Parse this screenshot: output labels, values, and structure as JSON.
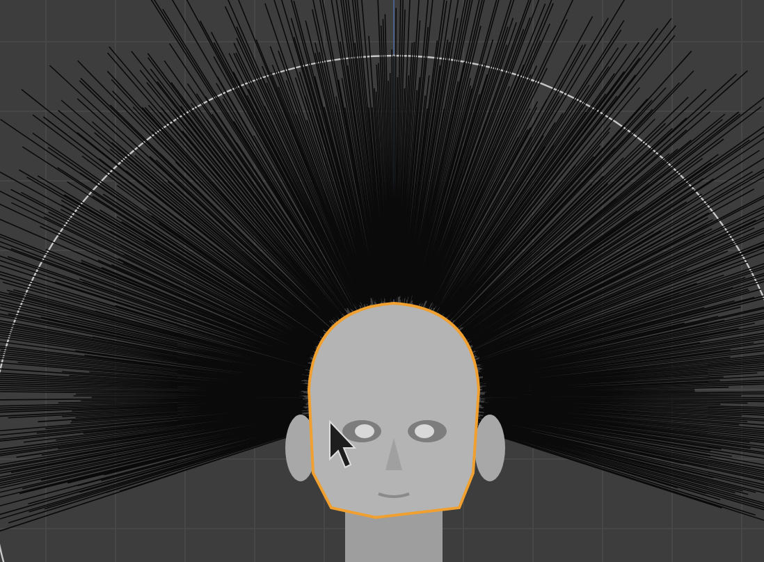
{
  "viewport": {
    "objects": [
      {
        "kind": "head",
        "selected": true
      }
    ]
  }
}
